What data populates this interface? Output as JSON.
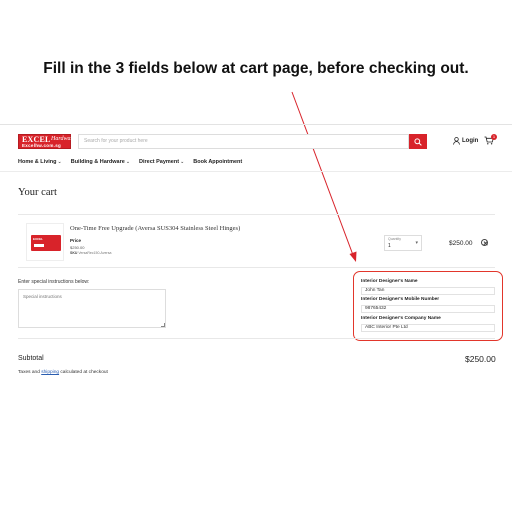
{
  "headline": "Fill in the 3 fields below at cart page, before checking out.",
  "header": {
    "logo_main": "EXCEL",
    "logo_script": "Hardware",
    "logo_sub": "Excelhw.com.sg",
    "search_placeholder": "Search for your product here",
    "login_label": "Login",
    "cart_count": "1"
  },
  "nav": {
    "items": [
      {
        "label": "Home & Living",
        "dropdown": true
      },
      {
        "label": "Building & Hardware",
        "dropdown": true
      },
      {
        "label": "Direct Payment",
        "dropdown": true
      },
      {
        "label": "Book Appointment",
        "dropdown": false
      }
    ]
  },
  "cart": {
    "title": "Your cart",
    "item": {
      "name": "One-Time Free Upgrade (Aversa SUS304 Stainless Steel Hinges)",
      "price_label": "Price",
      "price": "$250.00",
      "sku_label": "SKU",
      "sku": "VersaRec150-Aversa",
      "qty_label": "Quantity",
      "qty": "1",
      "line_total": "$250.00"
    },
    "instructions_label": "Enter special instructions below:",
    "instructions_placeholder": "Special instructions",
    "fields": [
      {
        "label": "Interior Designer's Name",
        "value": "John Tan"
      },
      {
        "label": "Interior Designer's Mobile Number",
        "value": "98765432"
      },
      {
        "label": "Interior Designer's Company Name",
        "value": "ABC Interior Pte Ltd"
      }
    ],
    "subtotal_label": "Subtotal",
    "subtotal": "$250.00",
    "taxes_before": "Taxes and ",
    "taxes_link": "shipping",
    "taxes_after": " calculated at checkout"
  },
  "colors": {
    "brand": "#d8232a",
    "highlight": "#e2362b"
  }
}
